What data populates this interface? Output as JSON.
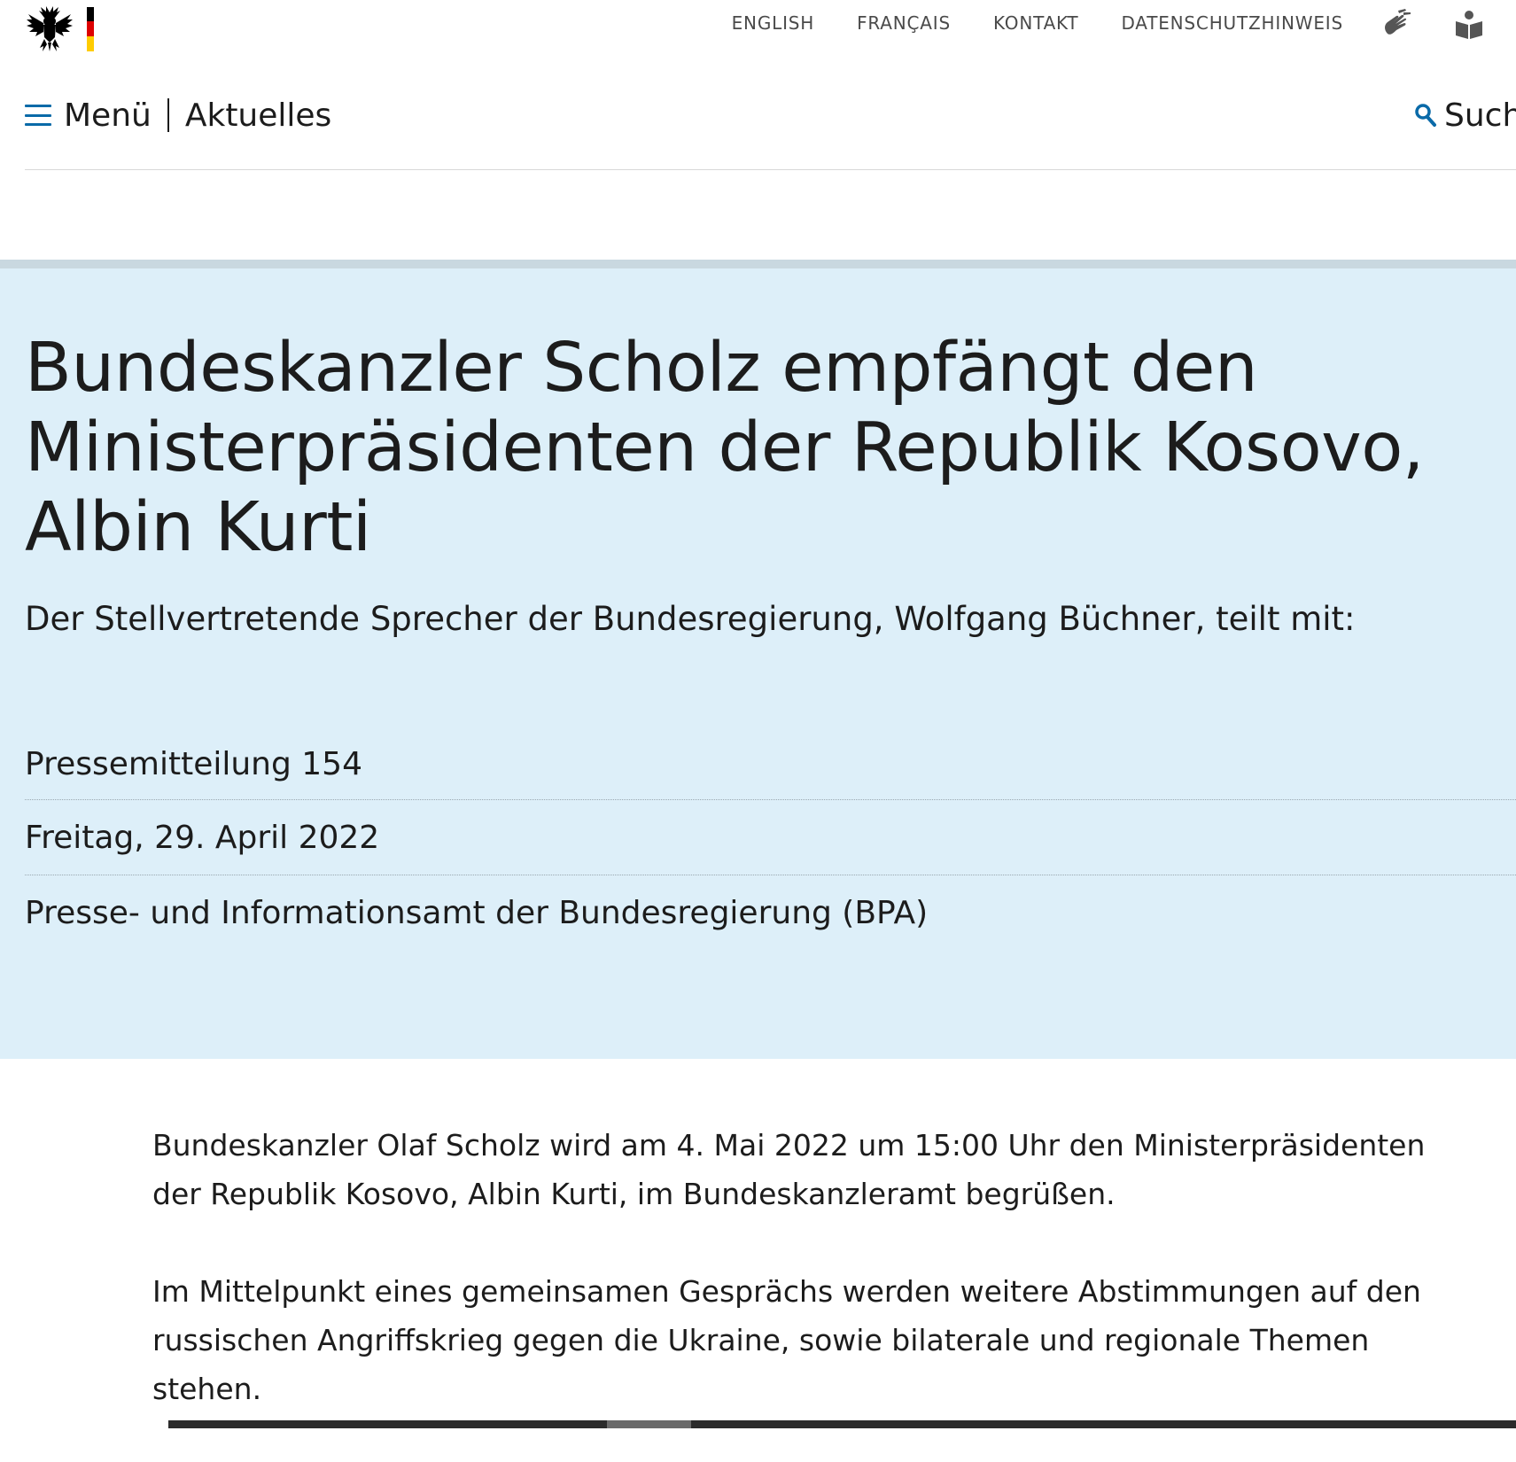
{
  "header": {
    "logo_icon": "federal-eagle-icon",
    "flag_colors": [
      "#000000",
      "#dd0000",
      "#ffcc00"
    ],
    "nav": [
      {
        "label": "ENGLISH"
      },
      {
        "label": "FRANÇAIS"
      },
      {
        "label": "KONTAKT"
      },
      {
        "label": "DATENSCHUTZHINWEIS"
      }
    ],
    "icons": [
      "sign-language-icon",
      "easy-language-icon"
    ]
  },
  "menubar": {
    "menu_label": "Menü",
    "section_label": "Aktuelles",
    "search_label": "Such",
    "accent_color": "#0a6aa8"
  },
  "hero": {
    "background_color": "#ddeff9",
    "title": "Bundeskanzler Scholz empfängt den Ministerpräsidenten der Republik Kosovo, Albin Kurti",
    "subtitle": "Der Stellvertretende Sprecher der Bundesregierung, Wolfgang Büchner, teilt mit:",
    "meta": [
      {
        "text": "Pressemitteilung 154"
      },
      {
        "text": "Freitag, 29. April 2022"
      },
      {
        "text": "Presse- und Informationsamt der Bundesregierung (BPA)"
      }
    ]
  },
  "article": {
    "paragraphs": [
      "Bundeskanzler Olaf Scholz wird am 4. Mai 2022 um 15:00 Uhr den Ministerpräsidenten der Republik Kosovo, Albin Kurti, im Bundeskanzleramt begrüßen.",
      "Im Mittelpunkt eines gemeinsamen Gesprächs werden weitere Abstimmungen auf den russischen Angriffskrieg gegen die Ukraine, sowie bilaterale und regionale Themen stehen."
    ]
  }
}
